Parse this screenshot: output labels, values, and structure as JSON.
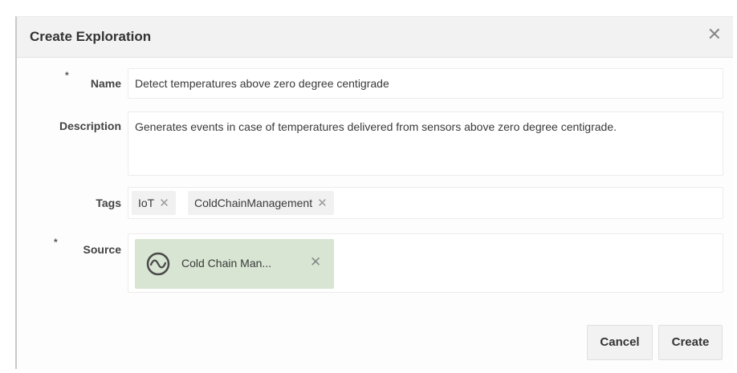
{
  "dialog": {
    "title": "Create Exploration",
    "close_icon": "close-icon",
    "required_marker": "*"
  },
  "form": {
    "name": {
      "label": "Name",
      "value": "Detect temperatures above zero degree centigrade"
    },
    "description": {
      "label": "Description",
      "value": "Generates events in case of temperatures delivered from sensors above zero degree centigrade."
    },
    "tags": {
      "label": "Tags",
      "items": [
        "IoT",
        "ColdChainManagement"
      ],
      "remove_glyph": "✕"
    },
    "source": {
      "label": "Source",
      "value": "Cold Chain Man...",
      "icon": "stream-icon",
      "chip_color": "#d8e5d2",
      "remove_glyph": "✕"
    }
  },
  "buttons": {
    "cancel": "Cancel",
    "create": "Create"
  }
}
